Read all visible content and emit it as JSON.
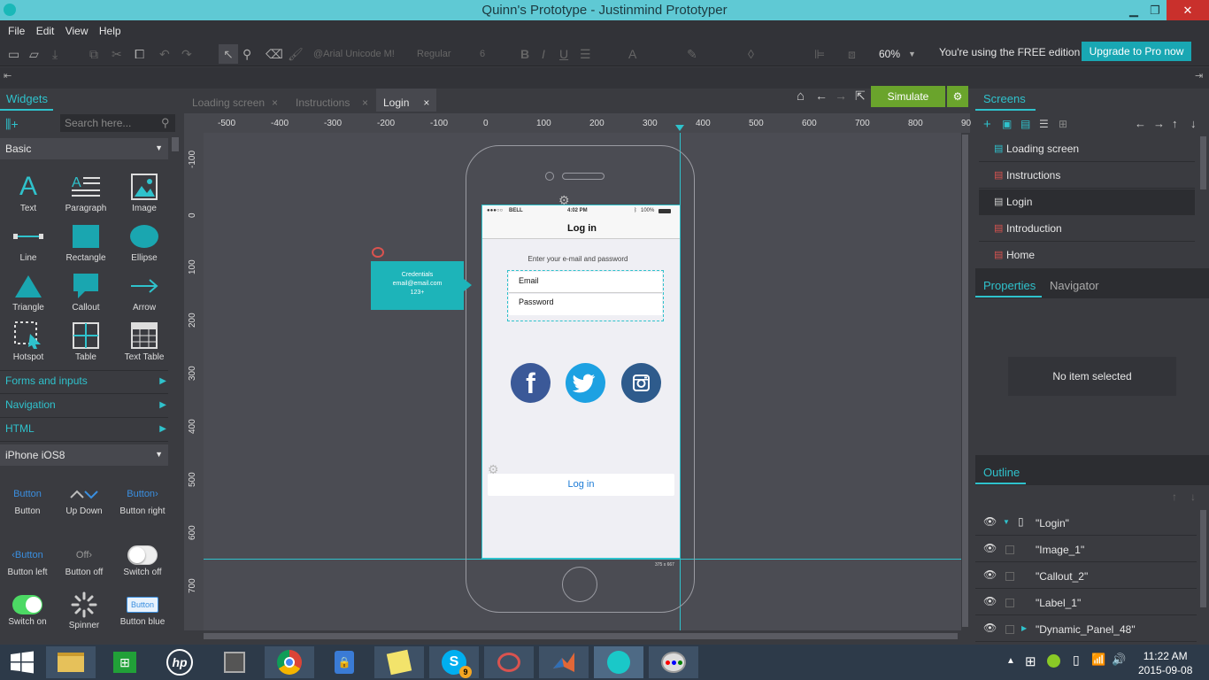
{
  "window": {
    "title": "Quinn's Prototype - Justinmind Prototyper"
  },
  "menu": [
    "File",
    "Edit",
    "View",
    "Help"
  ],
  "toolbar": {
    "font": "@Arial Unicode M!",
    "weight": "Regular",
    "size": "6",
    "bold": "B",
    "italic": "I",
    "underline": "U",
    "zoom": "60%",
    "free_text": "You're using the FREE edition",
    "upgrade_label": "Upgrade to Pro now"
  },
  "widgets_panel": {
    "title": "Widgets",
    "search_placeholder": "Search here...",
    "basic_label": "Basic",
    "basic_items": [
      "Text",
      "Paragraph",
      "Image",
      "Line",
      "Rectangle",
      "Ellipse",
      "Triangle",
      "Callout",
      "Arrow",
      "Hotspot",
      "Table",
      "Text Table"
    ],
    "categories": [
      "Forms and inputs",
      "Navigation",
      "HTML"
    ],
    "ios_label": "iPhone iOS8",
    "ios_items": [
      {
        "preview": "Button",
        "label": "Button"
      },
      {
        "preview": "",
        "label": "Up Down"
      },
      {
        "preview": "Button",
        "label": "Button right"
      },
      {
        "preview": "Button",
        "label": "Button left"
      },
      {
        "preview": "Off",
        "label": "Button off"
      },
      {
        "preview": "",
        "label": "Switch off"
      },
      {
        "preview": "",
        "label": "Switch on"
      },
      {
        "preview": "",
        "label": "Spinner"
      },
      {
        "preview": "Button",
        "label": "Button blue"
      }
    ]
  },
  "editor": {
    "tabs": [
      "Loading screen",
      "Instructions",
      "Login"
    ],
    "active_tab": "Login",
    "simulate_label": "Simulate",
    "ruler_top": [
      "-500",
      "-400",
      "-300",
      "-200",
      "-100",
      "0",
      "100",
      "200",
      "300",
      "400",
      "500",
      "600",
      "700",
      "800",
      "90"
    ],
    "ruler_left": [
      "-100",
      "0",
      "100",
      "200",
      "300",
      "400",
      "500",
      "600",
      "700"
    ],
    "callout_lines": [
      "Credentials",
      "email@email.com",
      "123+"
    ],
    "size_label": "375 x 667"
  },
  "phone": {
    "carrier": "BELL",
    "time": "4:02 PM",
    "battery": "100%",
    "nav_title": "Log in",
    "prompt": "Enter your e-mail and password",
    "email_label": "Email",
    "password_label": "Password",
    "login_button": "Log in"
  },
  "screens_panel": {
    "title": "Screens",
    "items": [
      "Loading screen",
      "Instructions",
      "Login",
      "Introduction",
      "Home"
    ],
    "active": "Login"
  },
  "properties_panel": {
    "tabs": [
      "Properties",
      "Navigator"
    ],
    "empty_text": "No item selected"
  },
  "outline_panel": {
    "title": "Outline",
    "items": [
      "\"Login\"",
      "\"Image_1\"",
      "\"Callout_2\"",
      "\"Label_1\"",
      "\"Dynamic_Panel_48\""
    ]
  },
  "taskbar": {
    "time": "11:22 AM",
    "date": "2015-09-08",
    "skype_badge": "9"
  },
  "colors": {
    "accent": "#2fc2cc",
    "simulate": "#6aa42c",
    "titlebar": "#5fc9d4"
  }
}
